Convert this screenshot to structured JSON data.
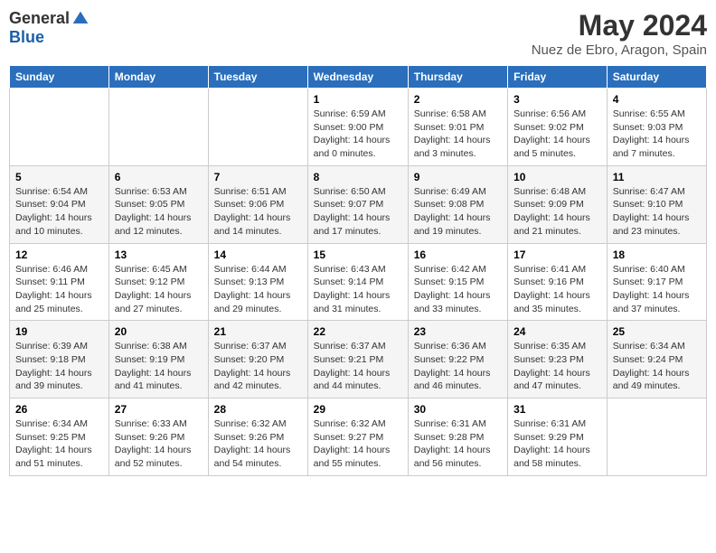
{
  "header": {
    "logo_general": "General",
    "logo_blue": "Blue",
    "title": "May 2024",
    "subtitle": "Nuez de Ebro, Aragon, Spain"
  },
  "weekdays": [
    "Sunday",
    "Monday",
    "Tuesday",
    "Wednesday",
    "Thursday",
    "Friday",
    "Saturday"
  ],
  "weeks": [
    [
      {
        "day": "",
        "sunrise": "",
        "sunset": "",
        "daylight": ""
      },
      {
        "day": "",
        "sunrise": "",
        "sunset": "",
        "daylight": ""
      },
      {
        "day": "",
        "sunrise": "",
        "sunset": "",
        "daylight": ""
      },
      {
        "day": "1",
        "sunrise": "Sunrise: 6:59 AM",
        "sunset": "Sunset: 9:00 PM",
        "daylight": "Daylight: 14 hours and 0 minutes."
      },
      {
        "day": "2",
        "sunrise": "Sunrise: 6:58 AM",
        "sunset": "Sunset: 9:01 PM",
        "daylight": "Daylight: 14 hours and 3 minutes."
      },
      {
        "day": "3",
        "sunrise": "Sunrise: 6:56 AM",
        "sunset": "Sunset: 9:02 PM",
        "daylight": "Daylight: 14 hours and 5 minutes."
      },
      {
        "day": "4",
        "sunrise": "Sunrise: 6:55 AM",
        "sunset": "Sunset: 9:03 PM",
        "daylight": "Daylight: 14 hours and 7 minutes."
      }
    ],
    [
      {
        "day": "5",
        "sunrise": "Sunrise: 6:54 AM",
        "sunset": "Sunset: 9:04 PM",
        "daylight": "Daylight: 14 hours and 10 minutes."
      },
      {
        "day": "6",
        "sunrise": "Sunrise: 6:53 AM",
        "sunset": "Sunset: 9:05 PM",
        "daylight": "Daylight: 14 hours and 12 minutes."
      },
      {
        "day": "7",
        "sunrise": "Sunrise: 6:51 AM",
        "sunset": "Sunset: 9:06 PM",
        "daylight": "Daylight: 14 hours and 14 minutes."
      },
      {
        "day": "8",
        "sunrise": "Sunrise: 6:50 AM",
        "sunset": "Sunset: 9:07 PM",
        "daylight": "Daylight: 14 hours and 17 minutes."
      },
      {
        "day": "9",
        "sunrise": "Sunrise: 6:49 AM",
        "sunset": "Sunset: 9:08 PM",
        "daylight": "Daylight: 14 hours and 19 minutes."
      },
      {
        "day": "10",
        "sunrise": "Sunrise: 6:48 AM",
        "sunset": "Sunset: 9:09 PM",
        "daylight": "Daylight: 14 hours and 21 minutes."
      },
      {
        "day": "11",
        "sunrise": "Sunrise: 6:47 AM",
        "sunset": "Sunset: 9:10 PM",
        "daylight": "Daylight: 14 hours and 23 minutes."
      }
    ],
    [
      {
        "day": "12",
        "sunrise": "Sunrise: 6:46 AM",
        "sunset": "Sunset: 9:11 PM",
        "daylight": "Daylight: 14 hours and 25 minutes."
      },
      {
        "day": "13",
        "sunrise": "Sunrise: 6:45 AM",
        "sunset": "Sunset: 9:12 PM",
        "daylight": "Daylight: 14 hours and 27 minutes."
      },
      {
        "day": "14",
        "sunrise": "Sunrise: 6:44 AM",
        "sunset": "Sunset: 9:13 PM",
        "daylight": "Daylight: 14 hours and 29 minutes."
      },
      {
        "day": "15",
        "sunrise": "Sunrise: 6:43 AM",
        "sunset": "Sunset: 9:14 PM",
        "daylight": "Daylight: 14 hours and 31 minutes."
      },
      {
        "day": "16",
        "sunrise": "Sunrise: 6:42 AM",
        "sunset": "Sunset: 9:15 PM",
        "daylight": "Daylight: 14 hours and 33 minutes."
      },
      {
        "day": "17",
        "sunrise": "Sunrise: 6:41 AM",
        "sunset": "Sunset: 9:16 PM",
        "daylight": "Daylight: 14 hours and 35 minutes."
      },
      {
        "day": "18",
        "sunrise": "Sunrise: 6:40 AM",
        "sunset": "Sunset: 9:17 PM",
        "daylight": "Daylight: 14 hours and 37 minutes."
      }
    ],
    [
      {
        "day": "19",
        "sunrise": "Sunrise: 6:39 AM",
        "sunset": "Sunset: 9:18 PM",
        "daylight": "Daylight: 14 hours and 39 minutes."
      },
      {
        "day": "20",
        "sunrise": "Sunrise: 6:38 AM",
        "sunset": "Sunset: 9:19 PM",
        "daylight": "Daylight: 14 hours and 41 minutes."
      },
      {
        "day": "21",
        "sunrise": "Sunrise: 6:37 AM",
        "sunset": "Sunset: 9:20 PM",
        "daylight": "Daylight: 14 hours and 42 minutes."
      },
      {
        "day": "22",
        "sunrise": "Sunrise: 6:37 AM",
        "sunset": "Sunset: 9:21 PM",
        "daylight": "Daylight: 14 hours and 44 minutes."
      },
      {
        "day": "23",
        "sunrise": "Sunrise: 6:36 AM",
        "sunset": "Sunset: 9:22 PM",
        "daylight": "Daylight: 14 hours and 46 minutes."
      },
      {
        "day": "24",
        "sunrise": "Sunrise: 6:35 AM",
        "sunset": "Sunset: 9:23 PM",
        "daylight": "Daylight: 14 hours and 47 minutes."
      },
      {
        "day": "25",
        "sunrise": "Sunrise: 6:34 AM",
        "sunset": "Sunset: 9:24 PM",
        "daylight": "Daylight: 14 hours and 49 minutes."
      }
    ],
    [
      {
        "day": "26",
        "sunrise": "Sunrise: 6:34 AM",
        "sunset": "Sunset: 9:25 PM",
        "daylight": "Daylight: 14 hours and 51 minutes."
      },
      {
        "day": "27",
        "sunrise": "Sunrise: 6:33 AM",
        "sunset": "Sunset: 9:26 PM",
        "daylight": "Daylight: 14 hours and 52 minutes."
      },
      {
        "day": "28",
        "sunrise": "Sunrise: 6:32 AM",
        "sunset": "Sunset: 9:26 PM",
        "daylight": "Daylight: 14 hours and 54 minutes."
      },
      {
        "day": "29",
        "sunrise": "Sunrise: 6:32 AM",
        "sunset": "Sunset: 9:27 PM",
        "daylight": "Daylight: 14 hours and 55 minutes."
      },
      {
        "day": "30",
        "sunrise": "Sunrise: 6:31 AM",
        "sunset": "Sunset: 9:28 PM",
        "daylight": "Daylight: 14 hours and 56 minutes."
      },
      {
        "day": "31",
        "sunrise": "Sunrise: 6:31 AM",
        "sunset": "Sunset: 9:29 PM",
        "daylight": "Daylight: 14 hours and 58 minutes."
      },
      {
        "day": "",
        "sunrise": "",
        "sunset": "",
        "daylight": ""
      }
    ]
  ]
}
